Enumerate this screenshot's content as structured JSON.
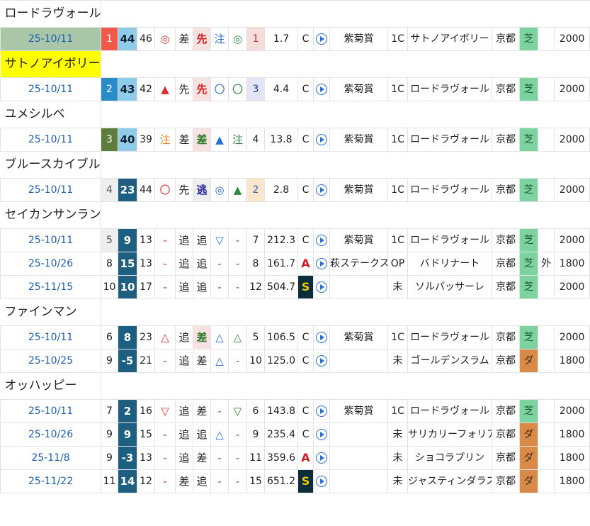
{
  "horses": [
    {
      "name": "ロードラヴォール",
      "highlight": false,
      "rows": [
        {
          "date": "25-10/11",
          "date_highlight": true,
          "rank": "1",
          "rank_style": "rk1",
          "score": "44",
          "score_style": "light",
          "num": "46",
          "mk1": "◎",
          "mk1c": "red",
          "pos1": "差",
          "pos2": "先",
          "pos2_style": "senko",
          "mk2": "注",
          "mk2c": "blue",
          "mk3": "◎",
          "mk3c": "green",
          "pop": "1",
          "pop_style": "pop1",
          "odds": "1.7",
          "grade": "C",
          "grade_style": "",
          "race": "紫菊賞",
          "cls": "1C",
          "winner": "サトノアイボリー",
          "venue": "京都",
          "surface": "芝",
          "surface_style": "turf",
          "course": "",
          "dist": "2000"
        }
      ]
    },
    {
      "name": "サトノアイボリー",
      "highlight": true,
      "rows": [
        {
          "date": "25-10/11",
          "date_highlight": false,
          "rank": "2",
          "rank_style": "rk2",
          "score": "43",
          "score_style": "light",
          "num": "42",
          "mk1": "▲",
          "mk1c": "red",
          "pos1": "先",
          "pos2": "先",
          "pos2_style": "senko",
          "mk2": "〇",
          "mk2c": "blue",
          "mk3": "〇",
          "mk3c": "green",
          "pop": "3",
          "pop_style": "pop3",
          "odds": "4.4",
          "grade": "C",
          "grade_style": "",
          "race": "紫菊賞",
          "cls": "1C",
          "winner": "ロードラヴォール",
          "venue": "京都",
          "surface": "芝",
          "surface_style": "turf",
          "course": "",
          "dist": "2000"
        }
      ]
    },
    {
      "name": "ユメシルベ",
      "highlight": false,
      "rows": [
        {
          "date": "25-10/11",
          "date_highlight": false,
          "rank": "3",
          "rank_style": "rk3",
          "score": "40",
          "score_style": "light",
          "num": "39",
          "mk1": "注",
          "mk1c": "orange",
          "pos1": "差",
          "pos2": "差",
          "pos2_style": "sashi",
          "mk2": "▲",
          "mk2c": "blue",
          "mk3": "注",
          "mk3c": "green",
          "pop": "4",
          "pop_style": "",
          "odds": "13.8",
          "grade": "C",
          "grade_style": "",
          "race": "紫菊賞",
          "cls": "1C",
          "winner": "ロードラヴォール",
          "venue": "京都",
          "surface": "芝",
          "surface_style": "turf",
          "course": "",
          "dist": "2000"
        }
      ]
    },
    {
      "name": "ブルースカイブルー",
      "highlight": false,
      "rows": [
        {
          "date": "25-10/11",
          "date_highlight": false,
          "rank": "4",
          "rank_style": "rkg",
          "score": "23",
          "score_style": "dark",
          "num": "44",
          "mk1": "〇",
          "mk1c": "red",
          "pos1": "先",
          "pos2": "逃",
          "pos2_style": "nige",
          "mk2": "◎",
          "mk2c": "blue",
          "mk3": "▲",
          "mk3c": "green",
          "pop": "2",
          "pop_style": "pop4",
          "odds": "2.8",
          "grade": "C",
          "grade_style": "",
          "race": "紫菊賞",
          "cls": "1C",
          "winner": "ロードラヴォール",
          "venue": "京都",
          "surface": "芝",
          "surface_style": "turf",
          "course": "",
          "dist": "2000"
        }
      ]
    },
    {
      "name": "セイカンサンラン",
      "highlight": false,
      "rows": [
        {
          "date": "25-10/11",
          "date_highlight": false,
          "rank": "5",
          "rank_style": "rkg",
          "score": "9",
          "score_style": "dark",
          "num": "13",
          "mk1": "-",
          "mk1c": "red",
          "pos1": "追",
          "pos2": "追",
          "pos2_style": "",
          "mk2": "▽",
          "mk2c": "blue",
          "mk3": "-",
          "mk3c": "green",
          "pop": "7",
          "pop_style": "",
          "odds": "212.3",
          "grade": "C",
          "grade_style": "",
          "race": "紫菊賞",
          "cls": "1C",
          "winner": "ロードラヴォール",
          "venue": "京都",
          "surface": "芝",
          "surface_style": "turf",
          "course": "",
          "dist": "2000"
        },
        {
          "date": "25-10/26",
          "date_highlight": false,
          "rank": "8",
          "rank_style": "",
          "score": "15",
          "score_style": "dark",
          "num": "13",
          "mk1": "-",
          "mk1c": "red",
          "pos1": "追",
          "pos2": "追",
          "pos2_style": "",
          "mk2": "-",
          "mk2c": "blue",
          "mk3": "-",
          "mk3c": "green",
          "pop": "8",
          "pop_style": "",
          "odds": "161.7",
          "grade": "A",
          "grade_style": "gA",
          "race": "萩ステークス",
          "cls": "OP",
          "winner": "バドリナート",
          "venue": "京都",
          "surface": "芝",
          "surface_style": "turf",
          "course": "外",
          "dist": "1800"
        },
        {
          "date": "25-11/15",
          "date_highlight": false,
          "rank": "10",
          "rank_style": "",
          "score": "10",
          "score_style": "dark",
          "num": "17",
          "mk1": "-",
          "mk1c": "red",
          "pos1": "追",
          "pos2": "追",
          "pos2_style": "",
          "mk2": "-",
          "mk2c": "blue",
          "mk3": "-",
          "mk3c": "green",
          "pop": "12",
          "pop_style": "",
          "odds": "504.7",
          "grade": "S",
          "grade_style": "gS",
          "race": "",
          "cls": "未",
          "winner": "ソルパッサーレ",
          "venue": "京都",
          "surface": "芝",
          "surface_style": "turf",
          "course": "",
          "dist": "2000"
        }
      ]
    },
    {
      "name": "ファインマン",
      "highlight": false,
      "rows": [
        {
          "date": "25-10/11",
          "date_highlight": false,
          "rank": "6",
          "rank_style": "",
          "score": "8",
          "score_style": "dark",
          "num": "23",
          "mk1": "△",
          "mk1c": "red",
          "pos1": "追",
          "pos2": "差",
          "pos2_style": "sashi",
          "mk2": "△",
          "mk2c": "blue",
          "mk3": "△",
          "mk3c": "green",
          "pop": "5",
          "pop_style": "",
          "odds": "106.5",
          "grade": "C",
          "grade_style": "",
          "race": "紫菊賞",
          "cls": "1C",
          "winner": "ロードラヴォール",
          "venue": "京都",
          "surface": "芝",
          "surface_style": "turf",
          "course": "",
          "dist": "2000"
        },
        {
          "date": "25-10/25",
          "date_highlight": false,
          "rank": "9",
          "rank_style": "",
          "score": "-5",
          "score_style": "dark",
          "num": "21",
          "mk1": "-",
          "mk1c": "red",
          "pos1": "追",
          "pos2": "差",
          "pos2_style": "",
          "mk2": "△",
          "mk2c": "blue",
          "mk3": "-",
          "mk3c": "green",
          "pop": "10",
          "pop_style": "",
          "odds": "125.0",
          "grade": "C",
          "grade_style": "",
          "race": "",
          "cls": "未",
          "winner": "ゴールデンスラム",
          "venue": "京都",
          "surface": "ダ",
          "surface_style": "dirt",
          "course": "",
          "dist": "1800"
        }
      ]
    },
    {
      "name": "オッハッピー",
      "highlight": false,
      "rows": [
        {
          "date": "25-10/11",
          "date_highlight": false,
          "rank": "7",
          "rank_style": "",
          "score": "2",
          "score_style": "dark",
          "num": "16",
          "mk1": "▽",
          "mk1c": "red",
          "pos1": "追",
          "pos2": "差",
          "pos2_style": "",
          "mk2": "-",
          "mk2c": "blue",
          "mk3": "▽",
          "mk3c": "green",
          "pop": "6",
          "pop_style": "",
          "odds": "143.8",
          "grade": "C",
          "grade_style": "",
          "race": "紫菊賞",
          "cls": "1C",
          "winner": "ロードラヴォール",
          "venue": "京都",
          "surface": "芝",
          "surface_style": "turf",
          "course": "",
          "dist": "2000"
        },
        {
          "date": "25-10/26",
          "date_highlight": false,
          "rank": "9",
          "rank_style": "",
          "score": "9",
          "score_style": "dark",
          "num": "15",
          "mk1": "-",
          "mk1c": "red",
          "pos1": "追",
          "pos2": "追",
          "pos2_style": "",
          "mk2": "△",
          "mk2c": "blue",
          "mk3": "-",
          "mk3c": "green",
          "pop": "9",
          "pop_style": "",
          "odds": "235.4",
          "grade": "C",
          "grade_style": "",
          "race": "",
          "cls": "未",
          "winner": "サリカリーフォリア",
          "venue": "京都",
          "surface": "ダ",
          "surface_style": "dirt",
          "course": "",
          "dist": "1800"
        },
        {
          "date": "25-11/8",
          "date_highlight": false,
          "rank": "9",
          "rank_style": "",
          "score": "-3",
          "score_style": "dark",
          "num": "13",
          "mk1": "-",
          "mk1c": "red",
          "pos1": "追",
          "pos2": "差",
          "pos2_style": "",
          "mk2": "-",
          "mk2c": "blue",
          "mk3": "-",
          "mk3c": "green",
          "pop": "11",
          "pop_style": "",
          "odds": "359.6",
          "grade": "A",
          "grade_style": "gA",
          "race": "",
          "cls": "未",
          "winner": "ショコラプリン",
          "venue": "京都",
          "surface": "ダ",
          "surface_style": "dirt",
          "course": "",
          "dist": "1800"
        },
        {
          "date": "25-11/22",
          "date_highlight": false,
          "rank": "11",
          "rank_style": "",
          "score": "14",
          "score_style": "dark",
          "num": "12",
          "mk1": "-",
          "mk1c": "red",
          "pos1": "差",
          "pos2": "追",
          "pos2_style": "",
          "mk2": "-",
          "mk2c": "blue",
          "mk3": "-",
          "mk3c": "green",
          "pop": "15",
          "pop_style": "",
          "odds": "651.2",
          "grade": "S",
          "grade_style": "gS",
          "race": "",
          "cls": "未",
          "winner": "ジャスティンダラス",
          "venue": "京都",
          "surface": "ダ",
          "surface_style": "dirt",
          "course": "",
          "dist": "1800"
        }
      ]
    }
  ],
  "icons": {
    "play": "play-circle-icon"
  }
}
